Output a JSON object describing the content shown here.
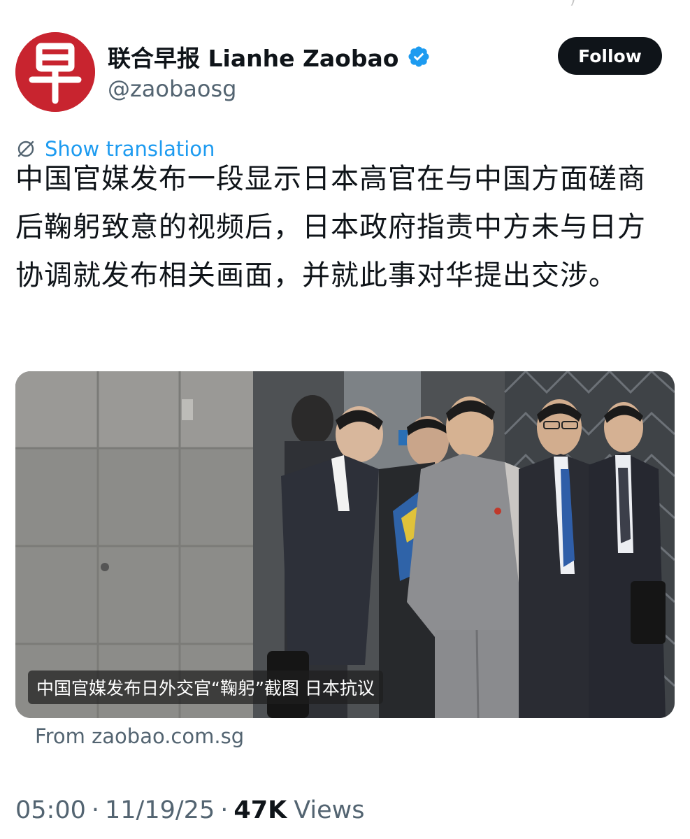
{
  "account": {
    "avatar_char": "早",
    "display_name": "联合早报 Lianhe Zaobao",
    "handle": "@zaobaosg",
    "verified": true
  },
  "follow_label": "Follow",
  "translation_label": "Show translation",
  "tweet_text": "中国官媒发布一段显示日本高官在与中国方面磋商后鞠躬致意的视频后，日本政府指责中方未与日方协调就发布相关画面，并就此事对华提出交涉。",
  "media": {
    "caption": "中国官媒发布日外交官“鞠躬”截图 日本抗议"
  },
  "link_source": "From zaobao.com.sg",
  "meta": {
    "time": "05:00",
    "date": "11/19/25",
    "views_count": "47K",
    "views_label": "Views",
    "separator": "·"
  },
  "icons": {
    "verified": "verified-badge-icon",
    "translate": "translate-globe-icon"
  },
  "colors": {
    "brand_red": "#c8242f",
    "link_blue": "#1d9bf0",
    "text_primary": "#0f1419",
    "text_secondary": "#536471"
  }
}
